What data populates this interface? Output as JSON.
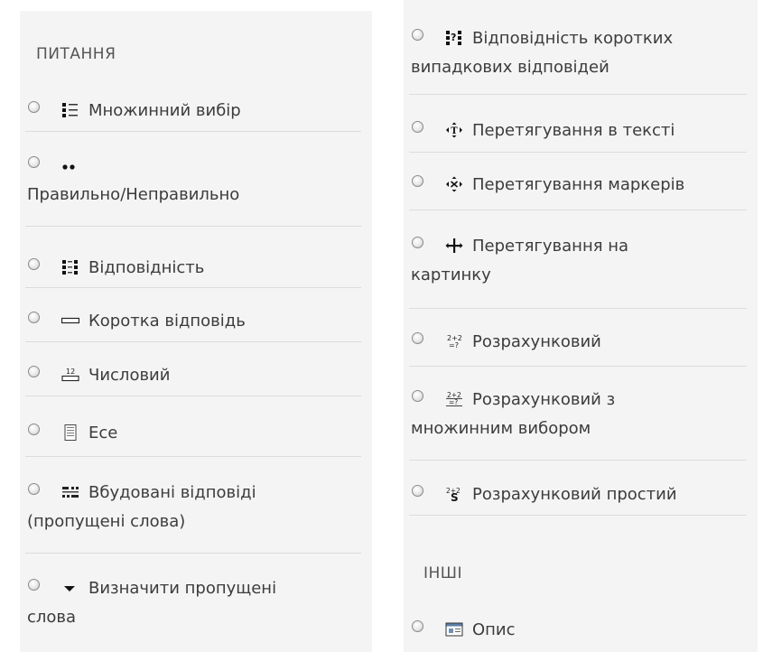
{
  "left": {
    "section_title": "ПИТАННЯ",
    "items": [
      {
        "label": "Множинний вибір",
        "icon": "multichoice-icon"
      },
      {
        "label": "",
        "wrap": "Правильно/Неправильно",
        "icon": "truefalse-icon"
      },
      {
        "label": "Відповідність",
        "icon": "match-icon"
      },
      {
        "label": "Коротка відповідь",
        "icon": "shortanswer-icon"
      },
      {
        "label": "Числовий",
        "icon": "numerical-icon"
      },
      {
        "label": "Есе",
        "icon": "essay-icon"
      },
      {
        "label": "Вбудовані відповіді",
        "wrap": "(пропущені слова)",
        "icon": "cloze-icon"
      },
      {
        "label": "Визначити пропущені",
        "wrap": "слова",
        "icon": "gapselect-icon"
      }
    ]
  },
  "right": {
    "items": [
      {
        "label": "Відповідність коротких",
        "wrap": "випадкових відповідей",
        "icon": "randomsamatch-icon"
      },
      {
        "label": "Перетягування в тексті",
        "icon": "ddwtos-icon"
      },
      {
        "label": "Перетягування маркерів",
        "icon": "ddmarker-icon"
      },
      {
        "label": "Перетягування на",
        "wrap": "картинку",
        "icon": "ddimageortext-icon"
      },
      {
        "label": "Розрахунковий",
        "icon": "calculated-icon"
      },
      {
        "label": "Розрахунковий з",
        "wrap": "множинним вибором",
        "icon": "calculatedmulti-icon"
      },
      {
        "label": "Розрахунковий простий",
        "icon": "calculatedsimple-icon"
      }
    ],
    "other_title": "ІНШІ",
    "other_items": [
      {
        "label": "Опис",
        "icon": "description-icon"
      }
    ]
  }
}
